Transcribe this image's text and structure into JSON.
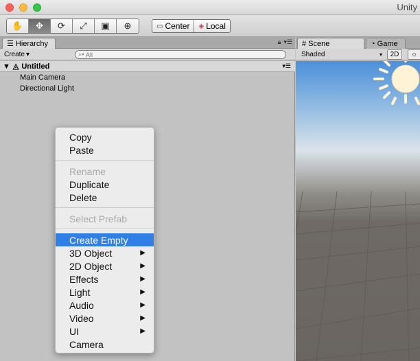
{
  "window": {
    "title": "Unity"
  },
  "toolbar": {
    "tools": [
      {
        "name": "hand-tool",
        "glyph": "✋"
      },
      {
        "name": "move-tool",
        "glyph": "✥"
      },
      {
        "name": "rotate-tool",
        "glyph": "⟳"
      },
      {
        "name": "scale-tool",
        "glyph": "⤢"
      },
      {
        "name": "rect-tool",
        "glyph": "▣"
      },
      {
        "name": "transform-tool",
        "glyph": "⊕"
      }
    ],
    "active_tool": "move-tool",
    "pivot_label": "Center",
    "space_label": "Local"
  },
  "hierarchy": {
    "tab_label": "Hierarchy",
    "create_label": "Create",
    "search_placeholder": "All",
    "scene_name": "Untitled",
    "items": [
      "Main Camera",
      "Directional Light"
    ]
  },
  "context_menu": {
    "groups": [
      [
        {
          "label": "Copy",
          "enabled": true
        },
        {
          "label": "Paste",
          "enabled": true
        }
      ],
      [
        {
          "label": "Rename",
          "enabled": false
        },
        {
          "label": "Duplicate",
          "enabled": true
        },
        {
          "label": "Delete",
          "enabled": true
        }
      ],
      [
        {
          "label": "Select Prefab",
          "enabled": false
        }
      ],
      [
        {
          "label": "Create Empty",
          "enabled": true,
          "highlighted": true
        },
        {
          "label": "3D Object",
          "enabled": true,
          "submenu": true
        },
        {
          "label": "2D Object",
          "enabled": true,
          "submenu": true
        },
        {
          "label": "Effects",
          "enabled": true,
          "submenu": true
        },
        {
          "label": "Light",
          "enabled": true,
          "submenu": true
        },
        {
          "label": "Audio",
          "enabled": true,
          "submenu": true
        },
        {
          "label": "Video",
          "enabled": true,
          "submenu": true
        },
        {
          "label": "UI",
          "enabled": true,
          "submenu": true
        },
        {
          "label": "Camera",
          "enabled": true
        }
      ]
    ]
  },
  "scene_view": {
    "tabs": [
      {
        "label": "Scene",
        "active": true
      },
      {
        "label": "Game",
        "active": false
      }
    ],
    "shading_mode": "Shaded",
    "mode_2d_label": "2D"
  },
  "colors": {
    "menu_highlight": "#2f7fe6",
    "panel_bg": "#c2c2c2",
    "sun": "#fff3d6"
  }
}
